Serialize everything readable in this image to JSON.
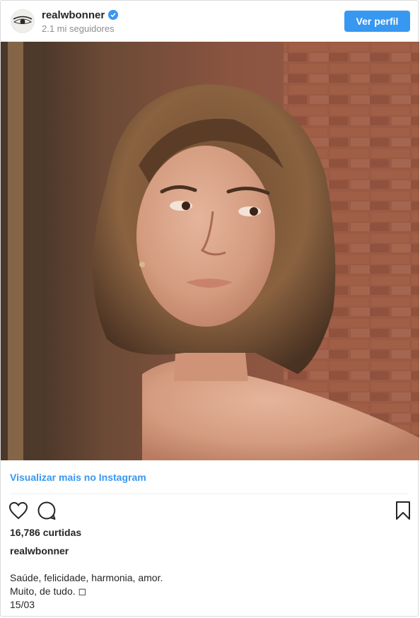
{
  "header": {
    "username": "realwbonner",
    "followers": "2.1 mi seguidores",
    "view_profile_label": "Ver perfil",
    "verified_color": "#3897f0"
  },
  "post": {
    "view_more_label": "Visualizar mais no Instagram",
    "likes": "16,786 curtidas",
    "caption_username": "realwbonner",
    "caption_lines": [
      "Saúde, felicidade, harmonia, amor.",
      "Muito, de tudo. ◻",
      "15/03"
    ]
  },
  "icons": {
    "like": "heart-icon",
    "comment": "comment-icon",
    "save": "bookmark-icon"
  },
  "colors": {
    "accent": "#3897f0",
    "text": "#262626",
    "muted": "#8e8e8e"
  }
}
